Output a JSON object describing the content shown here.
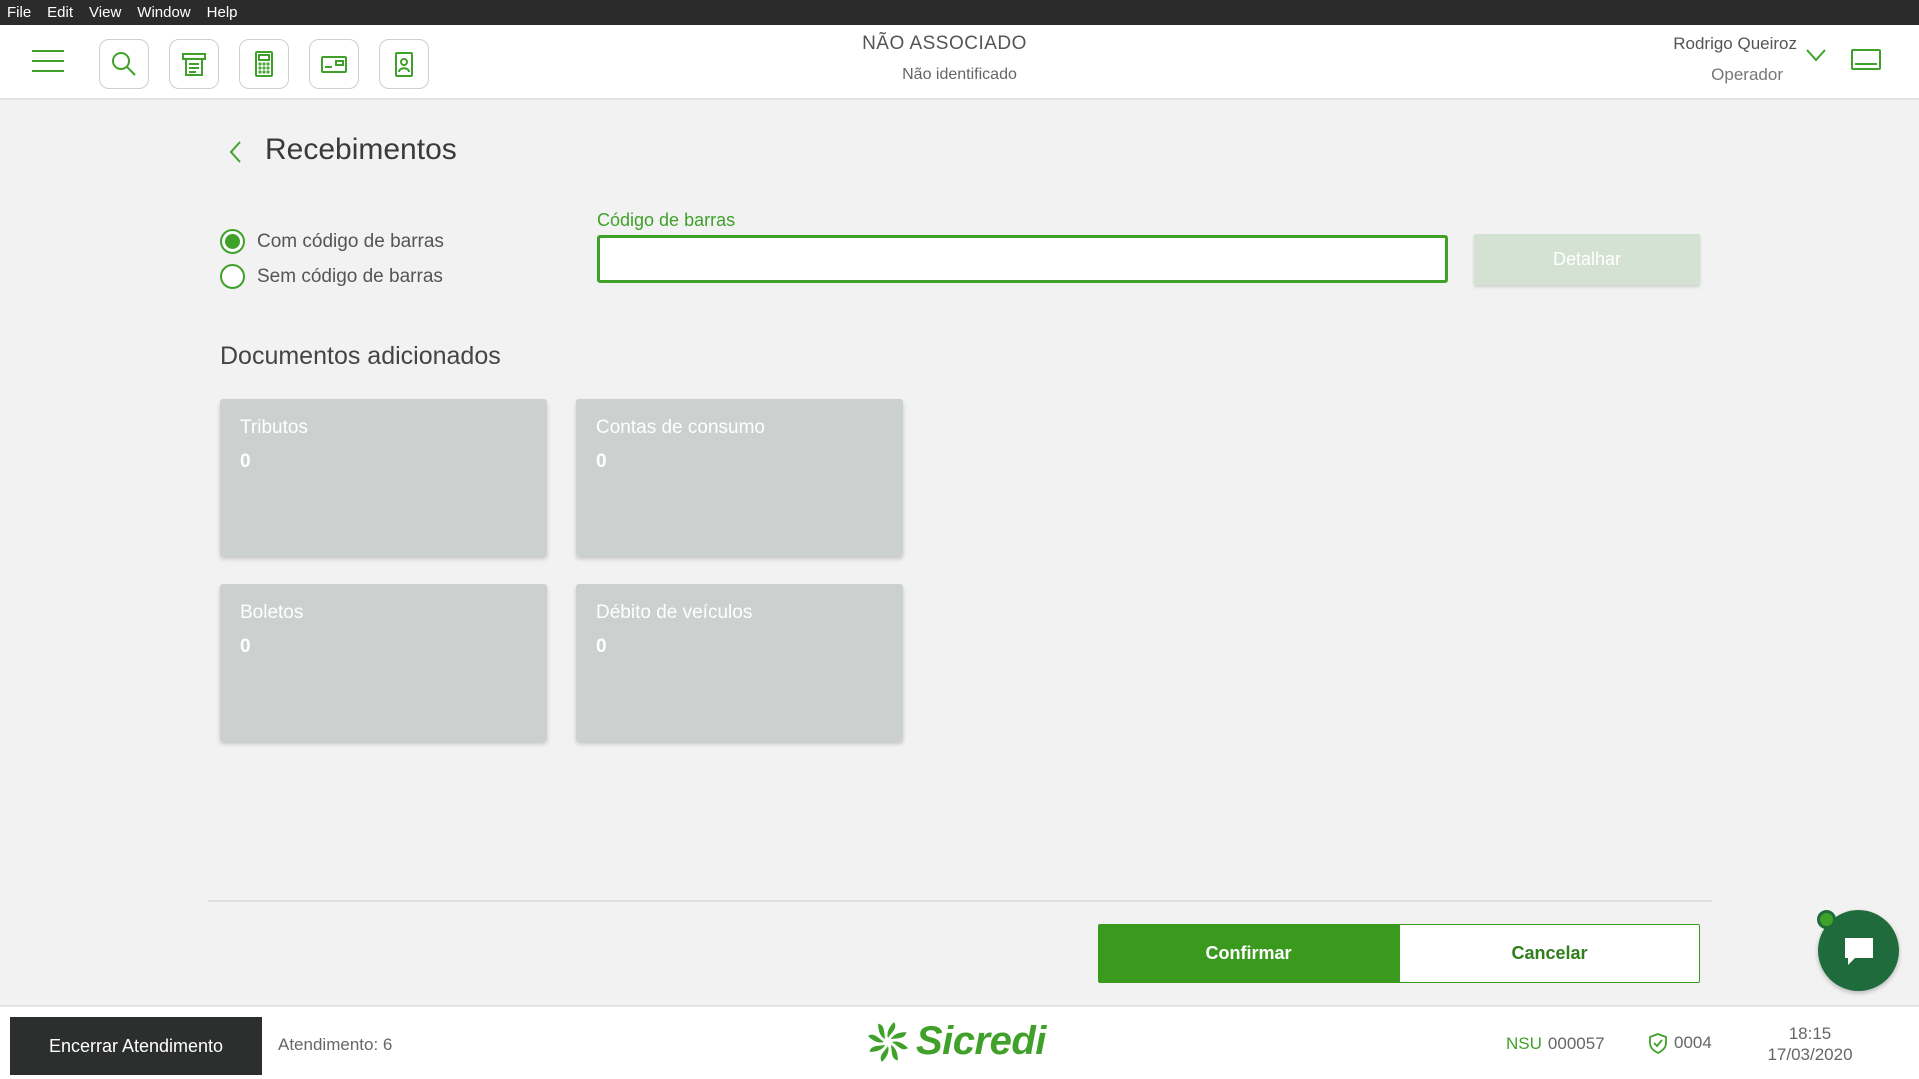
{
  "menu": {
    "items": [
      "File",
      "Edit",
      "View",
      "Window",
      "Help"
    ]
  },
  "header": {
    "associate_status": "NÃO ASSOCIADO",
    "associate_sub": "Não identificado",
    "user_name": "Rodrigo Queiroz",
    "user_role": "Operador"
  },
  "page": {
    "title": "Recebimentos",
    "radio_options": [
      {
        "label": "Com código de barras",
        "checked": true
      },
      {
        "label": "Sem código de barras",
        "checked": false
      }
    ],
    "barcode": {
      "label": "Código de barras",
      "value": "",
      "placeholder": ""
    },
    "detail_button": "Detalhar",
    "section_title": "Documentos adicionados",
    "cards": [
      {
        "label": "Tributos",
        "count": "0"
      },
      {
        "label": "Contas de consumo",
        "count": "0"
      },
      {
        "label": "Boletos",
        "count": "0"
      },
      {
        "label": "Débito de veículos",
        "count": "0"
      }
    ],
    "confirm_button": "Confirmar",
    "cancel_button": "Cancelar"
  },
  "footer": {
    "end_button": "Encerrar Atendimento",
    "atendimento": "Atendimento: 6",
    "logo_text": "Sicredi",
    "nsu_label": "NSU",
    "nsu_value": "000057",
    "terminal": "0004",
    "time": "18:15",
    "date": "17/03/2020"
  },
  "colors": {
    "accent": "#3fa12a",
    "dark": "#2c2f2d",
    "card": "#ccd0ce",
    "chat": "#1f6b3c"
  }
}
